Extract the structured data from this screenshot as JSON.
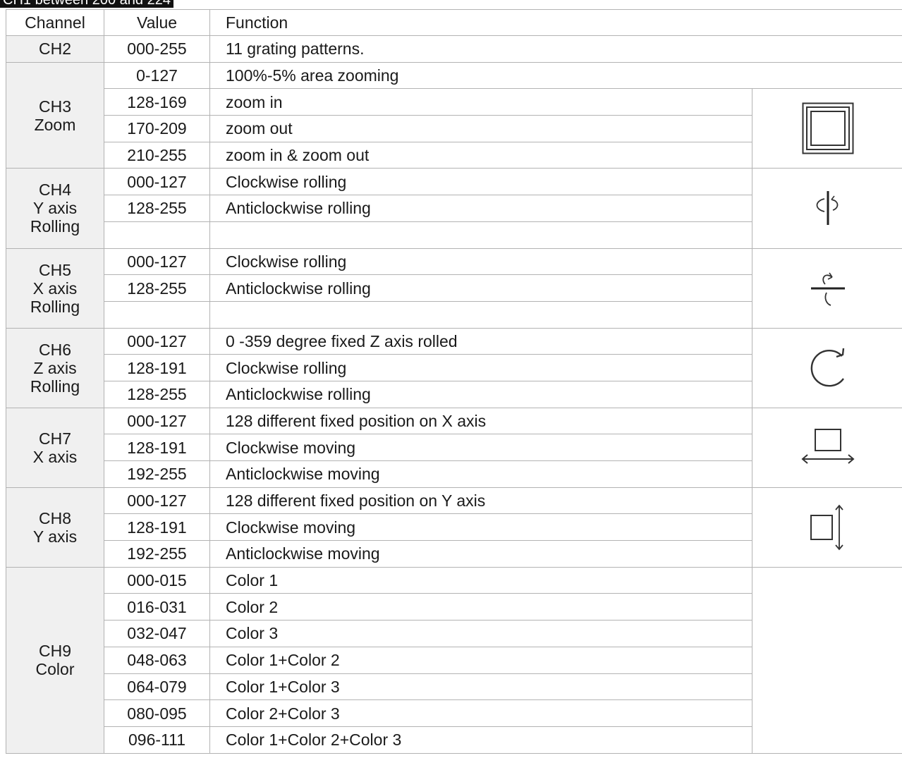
{
  "top_caption": "CH1 between 200 and 224",
  "headers": {
    "channel": "Channel",
    "value": "Value",
    "function": "Function"
  },
  "channels": {
    "ch2": {
      "lines": [
        "CH2"
      ]
    },
    "ch3": {
      "lines": [
        "CH3",
        "Zoom"
      ]
    },
    "ch4": {
      "lines": [
        "CH4",
        "Y axis",
        "Rolling"
      ]
    },
    "ch5": {
      "lines": [
        "CH5",
        "X axis",
        "Rolling"
      ]
    },
    "ch6": {
      "lines": [
        "CH6",
        "Z axis",
        "Rolling"
      ]
    },
    "ch7": {
      "lines": [
        "CH7",
        "X axis"
      ]
    },
    "ch8": {
      "lines": [
        "CH8",
        "Y axis"
      ]
    },
    "ch9": {
      "lines": [
        "CH9",
        "Color"
      ]
    }
  },
  "rows": [
    {
      "value": "000-255",
      "function": "11 grating patterns."
    },
    {
      "value": "0-127",
      "function": "100%-5% area zooming"
    },
    {
      "value": "128-169",
      "function": "zoom in"
    },
    {
      "value": "170-209",
      "function": "zoom out"
    },
    {
      "value": "210-255",
      "function": "zoom in & zoom out"
    },
    {
      "value": "000-127",
      "function": "Clockwise rolling"
    },
    {
      "value": "128-255",
      "function": "Anticlockwise rolling"
    },
    {
      "value": "",
      "function": ""
    },
    {
      "value": "000-127",
      "function": "Clockwise rolling"
    },
    {
      "value": "128-255",
      "function": "Anticlockwise rolling"
    },
    {
      "value": "",
      "function": ""
    },
    {
      "value": "000-127",
      "function": "0 -359 degree fixed Z axis rolled"
    },
    {
      "value": "128-191",
      "function": "Clockwise rolling"
    },
    {
      "value": "128-255",
      "function": "Anticlockwise rolling"
    },
    {
      "value": "000-127",
      "function": "128 different fixed position on X axis"
    },
    {
      "value": "128-191",
      "function": "Clockwise moving"
    },
    {
      "value": "192-255",
      "function": "Anticlockwise moving"
    },
    {
      "value": "000-127",
      "function": "128 different fixed position on Y axis"
    },
    {
      "value": "128-191",
      "function": "Clockwise moving"
    },
    {
      "value": "192-255",
      "function": "Anticlockwise moving"
    },
    {
      "value": "000-015",
      "function": "Color 1"
    },
    {
      "value": "016-031",
      "function": "Color 2"
    },
    {
      "value": "032-047",
      "function": "Color 3"
    },
    {
      "value": "048-063",
      "function": "Color 1+Color 2"
    },
    {
      "value": "064-079",
      "function": "Color 1+Color 3"
    },
    {
      "value": "080-095",
      "function": "Color 2+Color 3"
    },
    {
      "value": "096-111",
      "function": "Color 1+Color 2+Color 3"
    }
  ],
  "icons": {
    "zoom": "zoom-squares-icon",
    "y_roll": "y-axis-rotation-icon",
    "x_roll": "x-axis-rotation-icon",
    "z_roll": "z-axis-rotation-icon",
    "x_move": "x-axis-move-icon",
    "y_move": "y-axis-move-icon"
  },
  "colors": {
    "channel_bg": "#f0f0f0",
    "grid": "#b3b3b3",
    "caption_bg": "#111111"
  }
}
